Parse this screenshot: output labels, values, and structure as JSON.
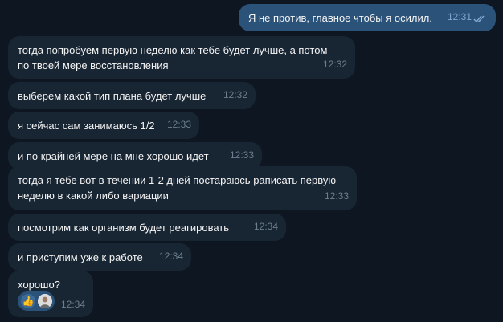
{
  "messages": [
    {
      "text": "Я не против, главное чтобы я осилил.",
      "time": "12:31",
      "outgoing": true
    },
    {
      "text": "тогда попробуем первую неделю как тебе будет лучше, а потом\nпо твоей мере восстановления",
      "time": "12:32"
    },
    {
      "text": "выберем какой тип плана будет лучше",
      "time": "12:32"
    },
    {
      "text": "я сейчас сам занимаюсь 1/2",
      "time": "12:33"
    },
    {
      "text": "и по крайней мере на мне хорошо идет",
      "time": "12:33"
    },
    {
      "text": "тогда я тебе вот в течении 1-2 дней постараюсь раписать первую\nнеделю в какой либо вариации",
      "time": "12:33"
    },
    {
      "text": "посмотрим как организм будет реагировать",
      "time": "12:34"
    },
    {
      "text": "и приступим уже к работе",
      "time": "12:34"
    },
    {
      "text": "хорошо?",
      "time": "12:34",
      "reaction": "thumbs-up-icon"
    }
  ],
  "colors": {
    "background": "#0e1621",
    "incoming_bubble": "#182533",
    "outgoing_bubble": "#2b5278",
    "time_incoming": "#6d7f8f",
    "time_outgoing": "#7da8d3"
  }
}
